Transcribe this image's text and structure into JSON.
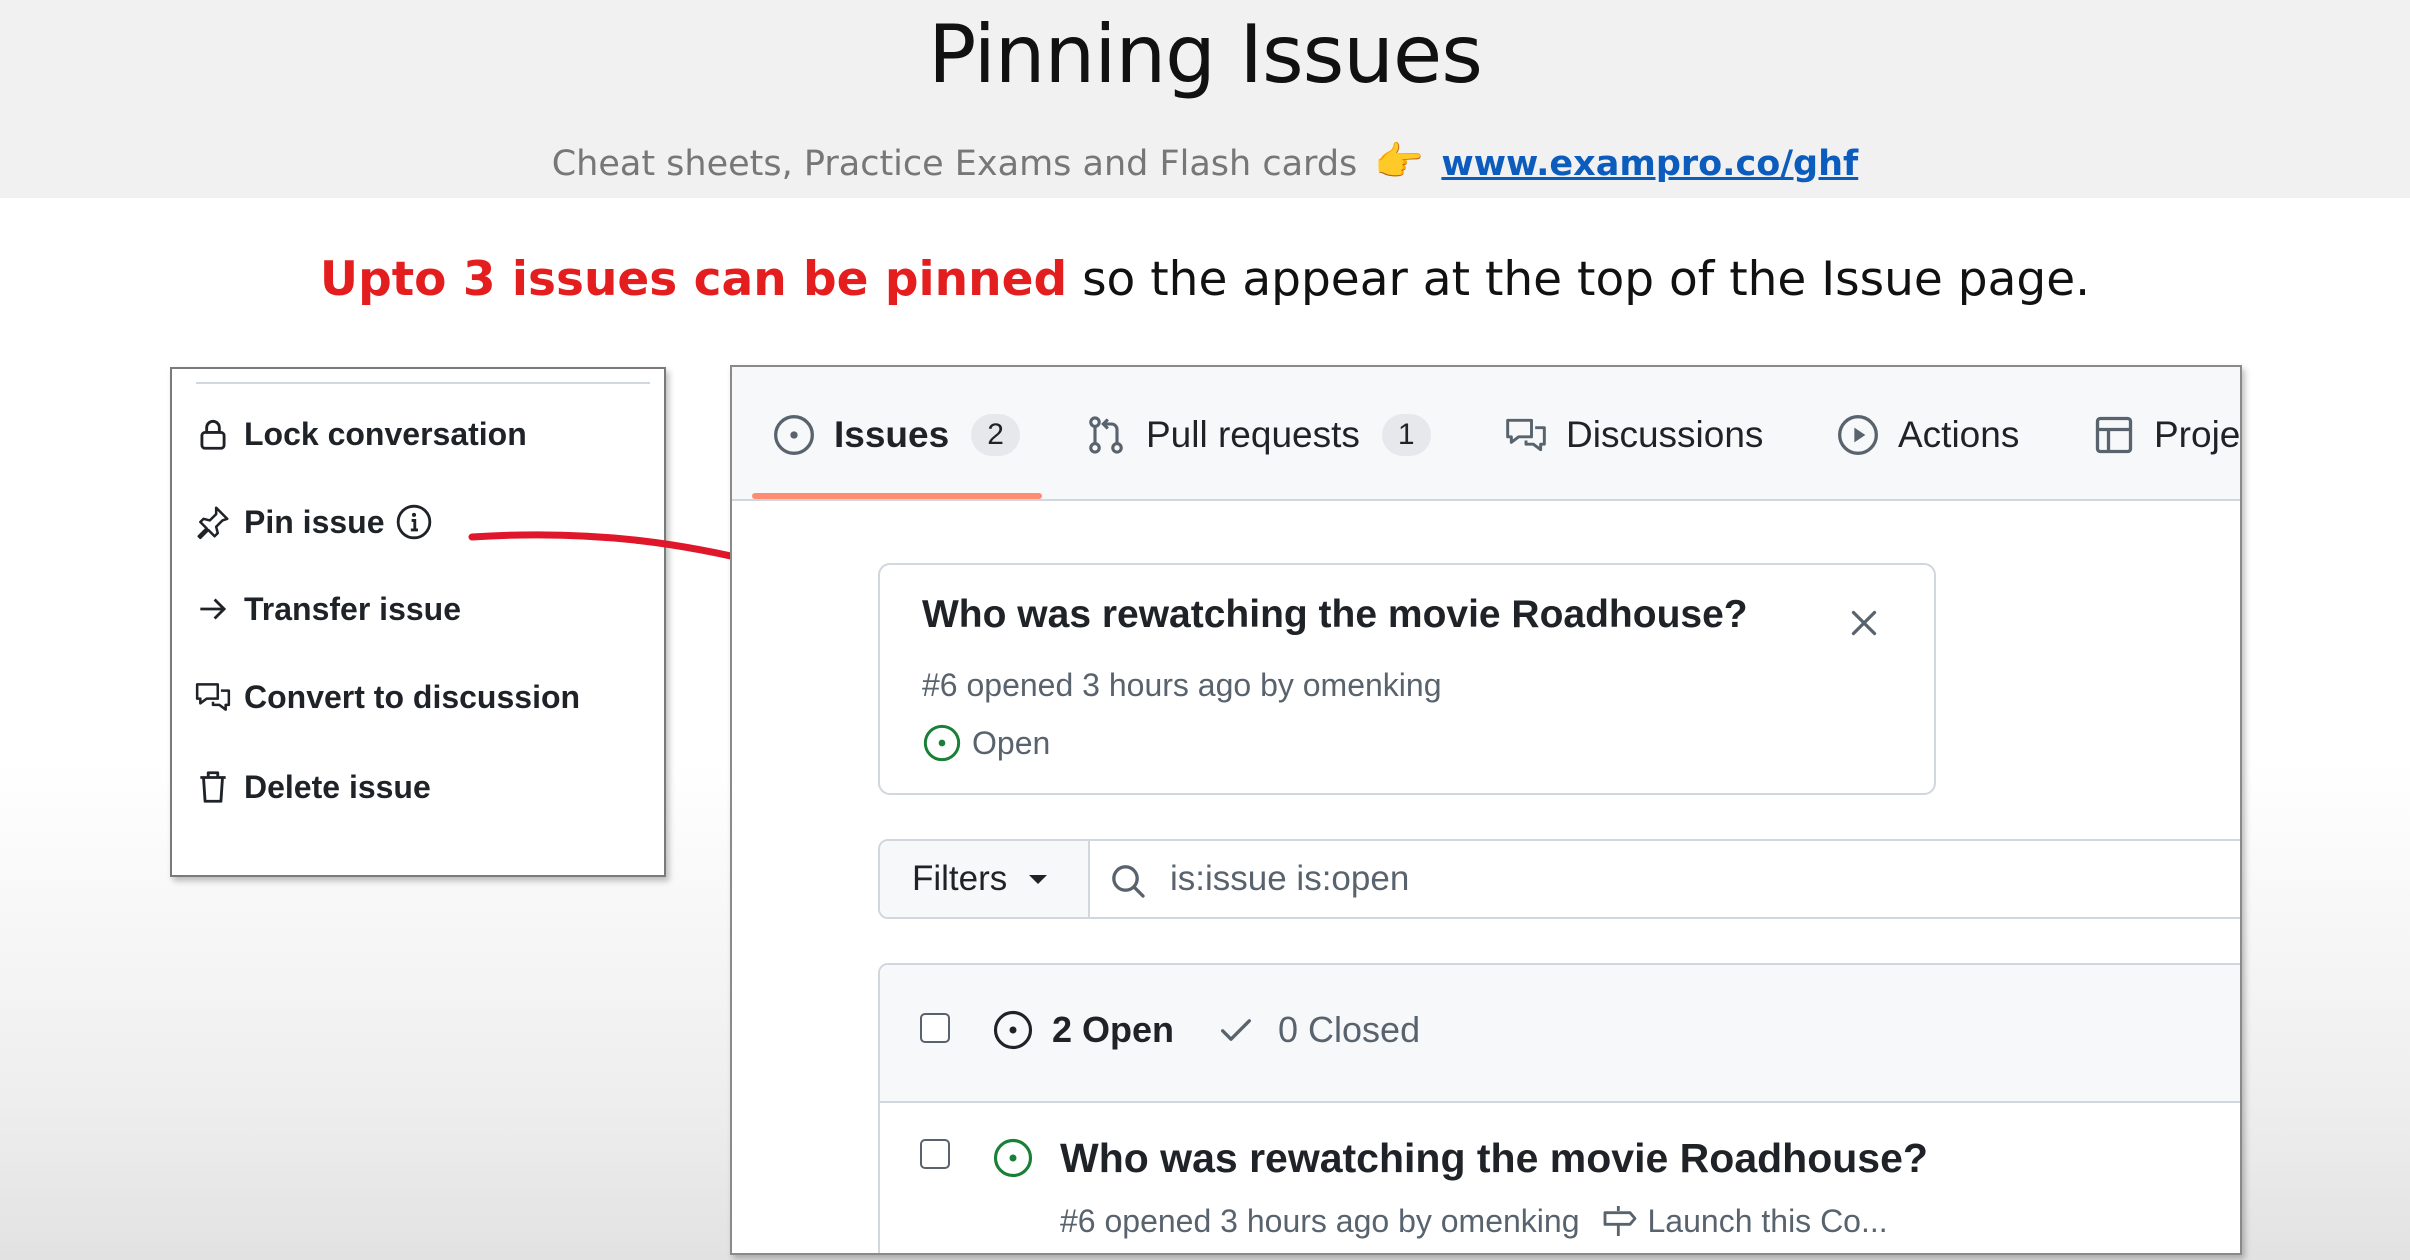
{
  "slide": {
    "title": "Pinning Issues",
    "subtitle_text": "Cheat sheets, Practice Exams and Flash cards",
    "subtitle_emoji": "👉",
    "subtitle_link": "www.exampro.co/ghf",
    "caption_highlight": "Upto 3 issues can be pinned",
    "caption_rest": " so the appear at the top of the Issue page."
  },
  "menu": {
    "items": [
      {
        "label": "Lock conversation",
        "icon": "lock-icon"
      },
      {
        "label": "Pin issue",
        "icon": "pin-icon"
      },
      {
        "label": "Transfer issue",
        "icon": "arrow-right-icon"
      },
      {
        "label": "Convert to discussion",
        "icon": "discussion-icon"
      },
      {
        "label": "Delete issue",
        "icon": "trash-icon"
      }
    ]
  },
  "tabs": [
    {
      "label": "Issues",
      "count": "2",
      "icon": "issue-opened-icon"
    },
    {
      "label": "Pull requests",
      "count": "1",
      "icon": "pull-request-icon"
    },
    {
      "label": "Discussions",
      "icon": "discussion-icon"
    },
    {
      "label": "Actions",
      "icon": "play-icon"
    },
    {
      "label": "Proje",
      "icon": "table-icon"
    }
  ],
  "pinned_issue": {
    "title": "Who was rewatching the movie Roadhouse?",
    "meta": "#6 opened 3 hours ago by omenking",
    "status": "Open"
  },
  "filters": {
    "button_label": "Filters",
    "search_value": "is:issue is:open"
  },
  "issue_list": {
    "open_label": "2 Open",
    "closed_label": "0 Closed",
    "rows": [
      {
        "title": "Who was rewatching the movie Roadhouse?",
        "meta": "#6 opened 3 hours ago by omenking",
        "milestone": "Launch this Co..."
      }
    ]
  },
  "colors": {
    "highlight_red": "#e41e1e",
    "link_blue": "#0b5cbd",
    "open_green": "#1a7f37",
    "tab_underline": "#fd8c73"
  }
}
